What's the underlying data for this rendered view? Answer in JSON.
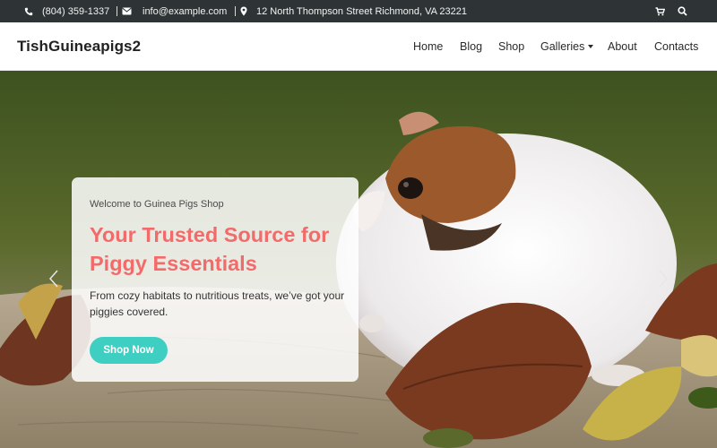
{
  "topbar": {
    "phone": "(804) 359-1337",
    "email": "info@example.com",
    "address": "12 North Thompson Street Richmond, VA 23221",
    "icons": [
      "phone-icon",
      "envelope-icon",
      "map-marker-icon",
      "cart-icon",
      "search-icon"
    ]
  },
  "header": {
    "brand": "TishGuineapigs2",
    "nav": [
      "Home",
      "Blog",
      "Shop",
      "Galleries",
      "About",
      "Contacts"
    ]
  },
  "hero": {
    "kicker": "Welcome to Guinea Pigs Shop",
    "title": "Your Trusted Source for Piggy Essentials",
    "description": "From cozy habitats to nutritious treats, we’ve got your piggies covered.",
    "button": "Shop Now"
  },
  "colors": {
    "topbar_bg": "#2e3436",
    "title_accent": "#f26b6b",
    "button_bg": "#3fcfc2"
  }
}
